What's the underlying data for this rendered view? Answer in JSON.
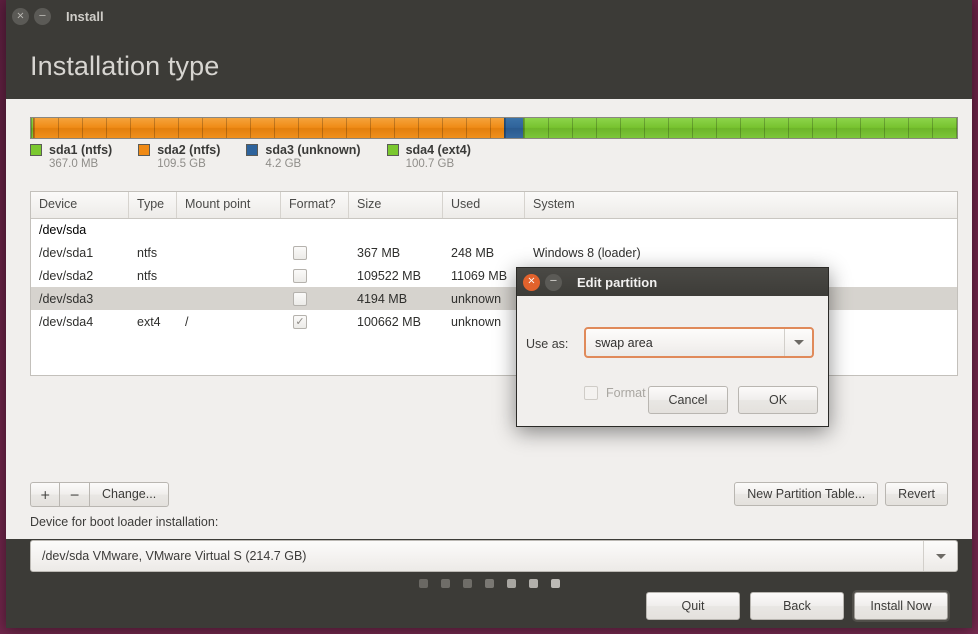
{
  "window": {
    "title": "Install",
    "heading": "Installation type",
    "close_icon": "close-icon",
    "minimize_icon": "minimize-icon",
    "close_glyph": "×",
    "minimize_glyph": "−"
  },
  "partition_bar": {
    "segments": [
      {
        "name": "sda1",
        "color": "#7bc82f",
        "percent": 0.17
      },
      {
        "name": "sda2",
        "color": "#f08a15",
        "percent": 51.0
      },
      {
        "name": "sda3",
        "color": "#2e639c",
        "percent": 1.95
      },
      {
        "name": "sda4",
        "color": "#7bc82f",
        "percent": 46.88
      }
    ]
  },
  "legend": [
    {
      "label": "sda1 (ntfs)",
      "size": "367.0 MB",
      "color": "green"
    },
    {
      "label": "sda2 (ntfs)",
      "size": "109.5 GB",
      "color": "orange"
    },
    {
      "label": "sda3 (unknown)",
      "size": "4.2 GB",
      "color": "blue"
    },
    {
      "label": "sda4 (ext4)",
      "size": "100.7 GB",
      "color": "green"
    }
  ],
  "table": {
    "columns": [
      "Device",
      "Type",
      "Mount point",
      "Format?",
      "Size",
      "Used",
      "System"
    ],
    "disk_row": "/dev/sda",
    "rows": [
      {
        "device": "/dev/sda1",
        "type": "ntfs",
        "mount": "",
        "format": false,
        "size": "367 MB",
        "used": "248 MB",
        "system": "Windows 8 (loader)",
        "selected": false
      },
      {
        "device": "/dev/sda2",
        "type": "ntfs",
        "mount": "",
        "format": false,
        "size": "109522 MB",
        "used": "11069 MB",
        "system": "",
        "selected": false
      },
      {
        "device": "/dev/sda3",
        "type": "",
        "mount": "",
        "format": false,
        "size": "4194 MB",
        "used": "unknown",
        "system": "",
        "selected": true
      },
      {
        "device": "/dev/sda4",
        "type": "ext4",
        "mount": "/",
        "format": true,
        "size": "100662 MB",
        "used": "unknown",
        "system": "",
        "selected": false
      }
    ],
    "checked_glyph": "✓"
  },
  "toolbar": {
    "add_label": "+",
    "remove_label": "−",
    "change_label": "Change...",
    "new_partition_table_label": "New Partition Table...",
    "revert_label": "Revert"
  },
  "bootloader": {
    "label": "Device for boot loader installation:",
    "value": "/dev/sda    VMware, VMware Virtual S (214.7 GB)"
  },
  "actions": {
    "quit_label": "Quit",
    "back_label": "Back",
    "install_label": "Install Now"
  },
  "progress_dots": {
    "count": 7,
    "shades": [
      "#6a6863",
      "#747views",
      "#6f6d68",
      "#7a7873",
      "#a6a49f",
      "#b0aea9",
      "#bab8b3"
    ]
  },
  "dialog": {
    "title": "Edit partition",
    "use_as_label": "Use as:",
    "use_as_value": "swap area",
    "format_label": "Format the partition:",
    "format_checked": false,
    "cancel_label": "Cancel",
    "ok_label": "OK",
    "close_glyph": "×",
    "minimize_glyph": "−"
  }
}
